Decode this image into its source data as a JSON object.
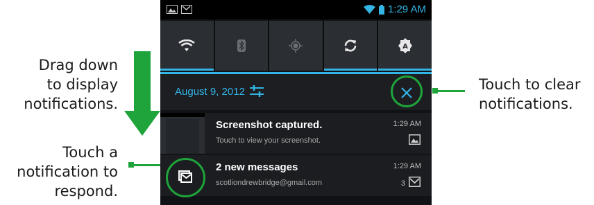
{
  "annotations": {
    "drag_lines": [
      "Drag down",
      "to display",
      "notifications."
    ],
    "touch_lines": [
      "Touch a",
      "notification to",
      "respond."
    ],
    "clear_lines": [
      "Touch to clear",
      "notifications."
    ]
  },
  "status_bar": {
    "time": "1:29 AM"
  },
  "header": {
    "date": "August 9, 2012"
  },
  "notifications": [
    {
      "title": "Screenshot captured.",
      "subtitle": "Touch to view your screenshot.",
      "time": "1:29 AM",
      "icon": "image-icon"
    },
    {
      "title": "2 new messages",
      "subtitle": "scotliondrewbridge@gmail.com",
      "time": "1:29 AM",
      "count": "3",
      "icon": "gmail-icon"
    }
  ],
  "colors": {
    "accent": "#33b5e5",
    "callout_green": "#1ea43b"
  }
}
